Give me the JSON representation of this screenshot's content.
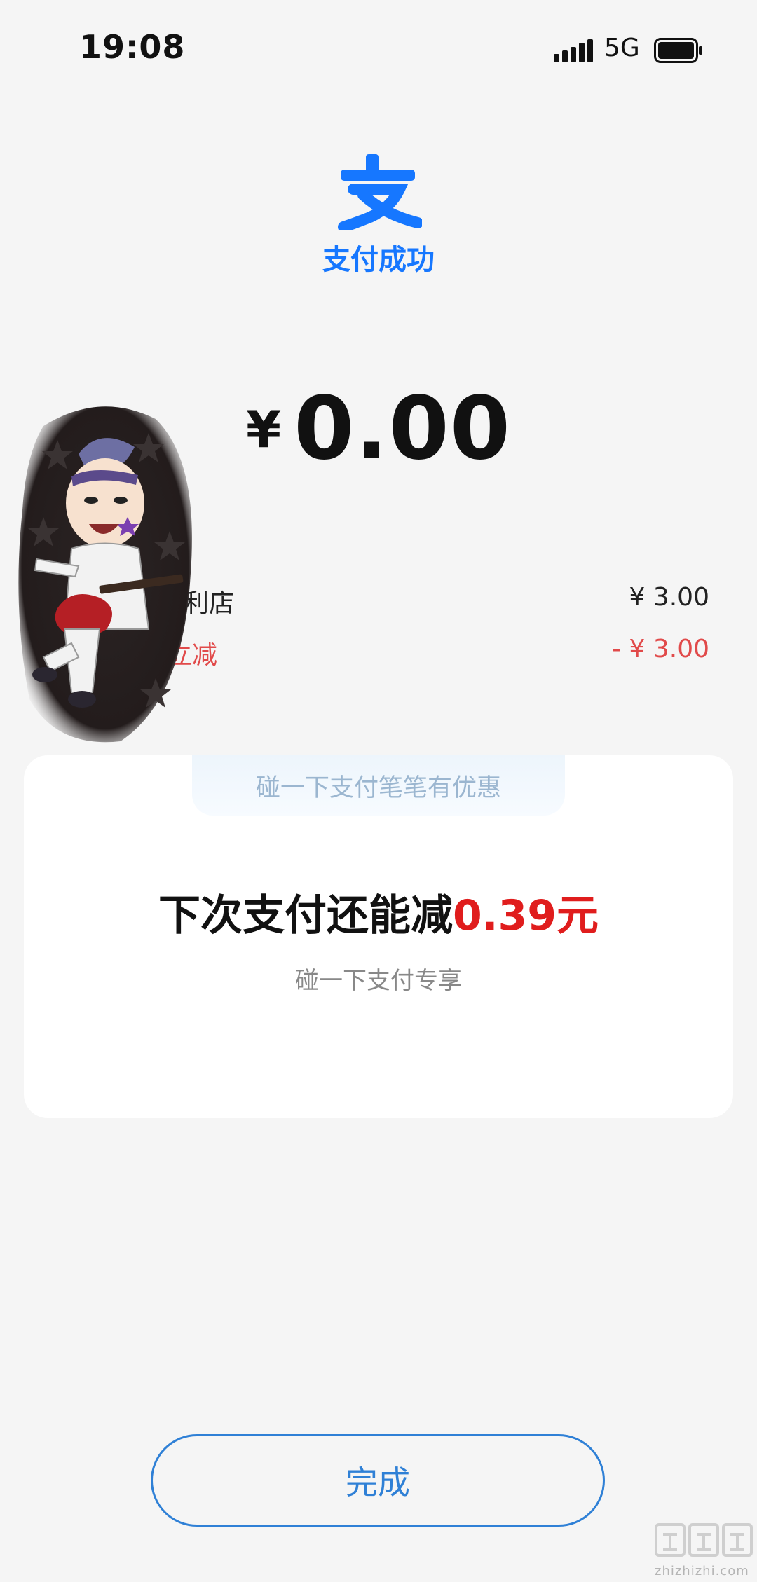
{
  "status_bar": {
    "time": "19:08",
    "network": "5G"
  },
  "header": {
    "title": "支付成功",
    "logo_icon": "alipay-logo-icon"
  },
  "payment": {
    "currency": "¥",
    "amount": "0.00"
  },
  "order": {
    "merchant_label": "利店",
    "merchant_value": "¥ 3.00",
    "discount_label": "立减",
    "discount_value": "- ¥ 3.00"
  },
  "promo_card": {
    "tab_text": "碰一下支付笔笔有优惠",
    "headline_prefix": "下次支付还能减",
    "headline_value": "0.39元",
    "subtitle": "碰一下支付专享"
  },
  "done_button_label": "完成",
  "watermark": {
    "text": "zhizhizhi.com"
  },
  "colors": {
    "brand_blue": "#1677ff",
    "discount_red": "#e14a4a",
    "highlight_red": "#e01d1d"
  }
}
